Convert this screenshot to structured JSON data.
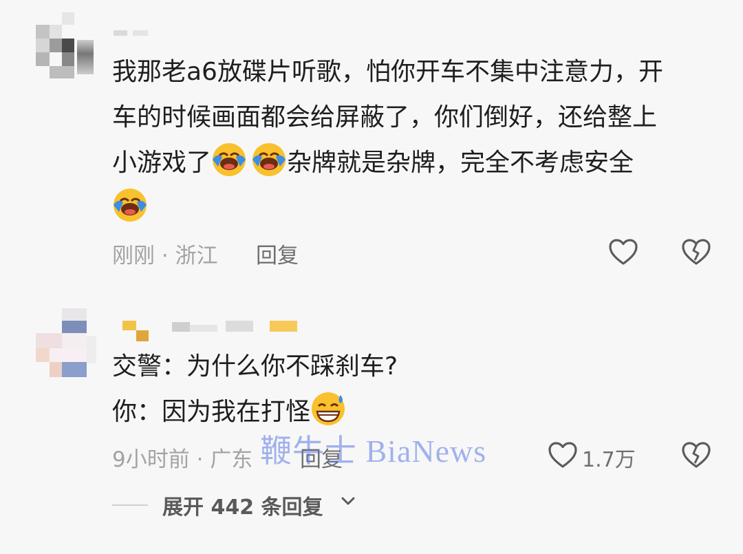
{
  "comments": [
    {
      "lines": [
        "我那老a6放碟片听歌，怕你开车不集中注意力，开",
        "车的时候画面都会给屏蔽了，你们倒好，还给整上",
        "小游戏了",
        "杂牌就是杂牌，完全不考虑安全"
      ],
      "time": "刚刚",
      "location": "浙江",
      "reply_label": "回复",
      "like_count": ""
    },
    {
      "lines": [
        "交警：为什么你不踩刹车?",
        "你：因为我在打怪"
      ],
      "time": "9小时前",
      "location": "广东",
      "reply_label": "回复",
      "like_count": "1.7万",
      "expand_label": "展开 442 条回复"
    }
  ],
  "separator": "·",
  "watermark": "鞭牛士 BiaNews",
  "icons": [
    "like-heart-icon",
    "dislike-broken-heart-icon",
    "laughing-tears-emoji",
    "grin-sweat-emoji",
    "chevron-down-icon"
  ],
  "colors": {
    "text": "#1e1e1e",
    "meta": "#a3a3a3",
    "emoji_yellow": "#f8c12d",
    "emoji_blue": "#3a8ee6"
  }
}
